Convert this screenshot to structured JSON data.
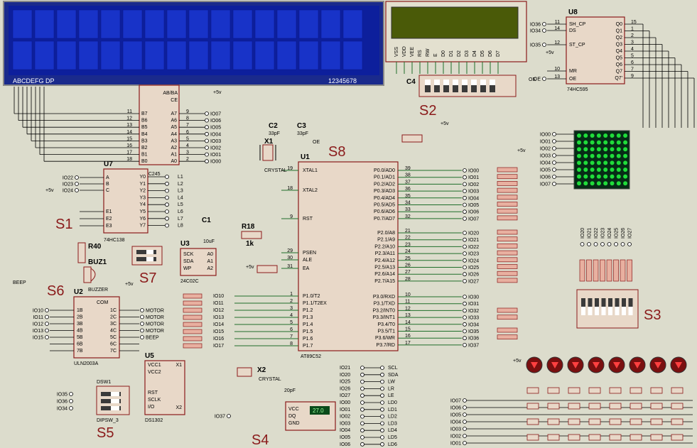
{
  "lcd1": {
    "bottom_left": "ABCDEFG DP",
    "bottom_right": "12345678"
  },
  "lcd2": {
    "pins": [
      "VSS",
      "VDD",
      "VEE",
      "RS",
      "RW",
      "E",
      "D0",
      "D1",
      "D2",
      "D3",
      "D4",
      "D5",
      "D6",
      "D7"
    ]
  },
  "u8": {
    "ref": "U8",
    "part": "74HC595",
    "left_pins": [
      "SH_CP",
      "DS",
      "ST_CP",
      "MR",
      "OE"
    ],
    "left_nums": [
      "11",
      "14",
      "12",
      "10",
      "13"
    ],
    "right_pins": [
      "Q0",
      "Q1",
      "Q2",
      "Q3",
      "Q4",
      "Q5",
      "Q6",
      "Q7",
      "Q7'"
    ],
    "right_nums": [
      "15",
      "1",
      "2",
      "3",
      "4",
      "5",
      "6",
      "7",
      "9"
    ],
    "left_nets": [
      "IO36",
      "IO34",
      "IO35"
    ],
    "oe_net": "OE"
  },
  "u7": {
    "ref": "U7",
    "part": "74HC138",
    "left_pins": [
      "A",
      "B",
      "C",
      "E1",
      "E2",
      "E3"
    ],
    "right_pins": [
      "Y0",
      "Y1",
      "Y2",
      "Y3",
      "Y4",
      "Y5",
      "Y6",
      "Y7"
    ],
    "nets": [
      "IO22",
      "IO23",
      "IO24"
    ]
  },
  "u1": {
    "ref": "U1",
    "part": "AT89C52",
    "left": [
      [
        "XTAL1",
        "19"
      ],
      [
        "XTAL2",
        "18"
      ],
      [
        "RST",
        "9"
      ],
      [
        "PSEN",
        "29"
      ],
      [
        "ALE",
        "30"
      ],
      [
        "EA",
        "31"
      ],
      [
        "P1.0/T2",
        "1"
      ],
      [
        "P1.1/T2EX",
        "2"
      ],
      [
        "P1.2",
        "3"
      ],
      [
        "P1.3",
        "4"
      ],
      [
        "P1.4",
        "5"
      ],
      [
        "P1.5",
        "6"
      ],
      [
        "P1.6",
        "7"
      ],
      [
        "P1.7",
        "8"
      ]
    ],
    "right": [
      [
        "P0.0/AD0",
        "39"
      ],
      [
        "P0.1/AD1",
        "38"
      ],
      [
        "P0.2/AD2",
        "37"
      ],
      [
        "P0.3/AD3",
        "36"
      ],
      [
        "P0.4/AD4",
        "35"
      ],
      [
        "P0.5/AD5",
        "34"
      ],
      [
        "P0.6/AD6",
        "33"
      ],
      [
        "P0.7/AD7",
        "32"
      ],
      [
        "P2.0/A8",
        "21"
      ],
      [
        "P2.1/A9",
        "22"
      ],
      [
        "P2.2/A10",
        "23"
      ],
      [
        "P2.3/A11",
        "24"
      ],
      [
        "P2.4/A12",
        "25"
      ],
      [
        "P2.5/A13",
        "26"
      ],
      [
        "P2.6/A14",
        "27"
      ],
      [
        "P2.7/A15",
        "28"
      ],
      [
        "P3.0/RXD",
        "10"
      ],
      [
        "P3.1/TXD",
        "11"
      ],
      [
        "P3.2/INT0",
        "12"
      ],
      [
        "P3.3/INT1",
        "13"
      ],
      [
        "P3.4/T0",
        "14"
      ],
      [
        "P3.5/T1",
        "15"
      ],
      [
        "P3.6/WR",
        "16"
      ],
      [
        "P3.7/RD",
        "17"
      ]
    ]
  },
  "p0_nets": [
    "IO00",
    "IO01",
    "IO02",
    "IO03",
    "IO04",
    "IO05",
    "IO06",
    "IO07"
  ],
  "p2_nets": [
    "IO20",
    "IO21",
    "IO22",
    "IO23",
    "IO24",
    "IO25",
    "IO26",
    "IO27"
  ],
  "p3_nets": [
    "IO30",
    "IO31",
    "IO32",
    "IO33",
    "IO34",
    "IO35",
    "IO36",
    "IO37"
  ],
  "p1_nets": [
    "IO10",
    "IO11",
    "IO12",
    "IO13",
    "IO14",
    "IO15",
    "IO16",
    "IO17"
  ],
  "u4": {
    "ref": "74HC245",
    "left_pins": [
      "B7",
      "B6",
      "B5",
      "B4",
      "B3",
      "B2",
      "B1",
      "B0"
    ],
    "left_nums": [
      "11",
      "12",
      "13",
      "14",
      "15",
      "16",
      "17",
      "18"
    ],
    "right_pins": [
      "A7",
      "A6",
      "A5",
      "A4",
      "A3",
      "A2",
      "A1",
      "A0"
    ],
    "right_nums": [
      "9",
      "8",
      "7",
      "6",
      "5",
      "4",
      "3",
      "2"
    ],
    "top_pins": [
      "AB/BA",
      "CE"
    ],
    "nets": [
      "IO07",
      "IO06",
      "IO05",
      "IO04",
      "IO03",
      "IO02",
      "IO01",
      "IO00"
    ]
  },
  "u3": {
    "ref": "U3",
    "part": "24C02C",
    "pins": [
      "SCK",
      "SDA",
      "WP",
      "A0",
      "A1",
      "A2"
    ]
  },
  "u2": {
    "ref": "U2",
    "part": "ULN2003A",
    "left": [
      "1B",
      "2B",
      "3B",
      "4B",
      "5B",
      "6B",
      "7B"
    ],
    "right": [
      "1C",
      "2C",
      "3C",
      "4C",
      "5C",
      "6C",
      "7C"
    ],
    "nets": [
      "IO10",
      "IO11",
      "IO12",
      "IO13",
      "IO15"
    ],
    "outs": [
      "MOTOR",
      "MOTOR",
      "MOTOR",
      "MOTOR",
      "BEEP"
    ]
  },
  "u5": {
    "ref": "U5",
    "part": "DS1302",
    "pins": [
      "VCC1",
      "VCC2",
      "RST",
      "SCLK",
      "I/O",
      "X1",
      "X2"
    ],
    "nets": [
      "IO35",
      "IO36",
      "IO34"
    ]
  },
  "labels": {
    "s1": "S1",
    "s2": "S2",
    "s3": "S3",
    "s4": "S4",
    "s5": "S5",
    "s6": "S6",
    "s7": "S7",
    "s8": "S8",
    "r18": "R18",
    "r40": "R40",
    "c1": "C1",
    "c2": "C2",
    "c3": "C3",
    "c4": "C4",
    "x1": "X1",
    "x2": "X2",
    "dsw": "DSW1",
    "buz": "BUZ1",
    "buzzer": "BUZZER",
    "beep": "BEEP",
    "crystal": "CRYSTAL",
    "plus5v": "+5v",
    "oe": "OE",
    "c2v": "33pF",
    "c3v": "33pF",
    "c1v": "10uF",
    "r18v": "1k",
    "x2cap": "20pF",
    "dipsw": "DIPSW_3"
  },
  "bus_right": [
    "SCL",
    "SDA",
    "LW",
    "LR",
    "LE",
    "LD0",
    "LD1",
    "LD2",
    "LD3",
    "LD4",
    "LD5",
    "LD6"
  ],
  "bus_left": [
    "IO21",
    "IO20",
    "IO25",
    "IO26",
    "IO27",
    "IO00",
    "IO01",
    "IO02",
    "IO03",
    "IO04",
    "IO05",
    "IO06"
  ],
  "matrix_nets": [
    "IO00",
    "IO01",
    "IO02",
    "IO03",
    "IO04",
    "IO05",
    "IO06",
    "IO07"
  ],
  "key_nets": [
    "IO07",
    "IO06",
    "IO05",
    "IO04",
    "IO03",
    "IO02",
    "IO01"
  ],
  "temp": {
    "pins": [
      "VCC",
      "DQ",
      "GND"
    ],
    "value": "27.0",
    "net": "IO37"
  }
}
